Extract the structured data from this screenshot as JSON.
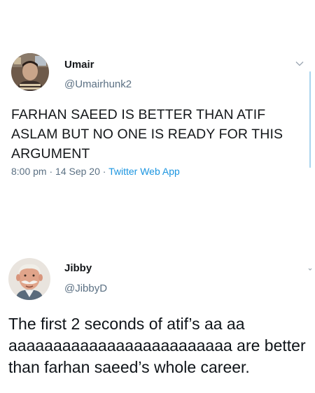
{
  "tweets": [
    {
      "author": {
        "name": "Umair",
        "handle": "@Umairhunk2"
      },
      "text": "FARHAN SAEED IS BETTER THAN ATIF ASLAM BUT NO ONE IS READY FOR THIS ARGUMENT",
      "meta": {
        "time": "8:00 pm",
        "sep1": " · ",
        "date": "14 Sep 20",
        "sep2": " · ",
        "source": "Twitter Web App"
      },
      "icons": {
        "menu": "chevron-down-icon"
      }
    },
    {
      "author": {
        "name": "Jibby",
        "handle": "@JibbyD"
      },
      "text": "The first 2 seconds of atif’s aa aa aaaaaaaaaaaaaaaaaaaaaaaaa are better than farhan saeed’s whole career.",
      "icons": {
        "menu": "chevron-down-icon"
      }
    }
  ],
  "colors": {
    "link": "#1b95e0",
    "secondary_text": "#5b7083",
    "primary_text": "#14171a"
  }
}
